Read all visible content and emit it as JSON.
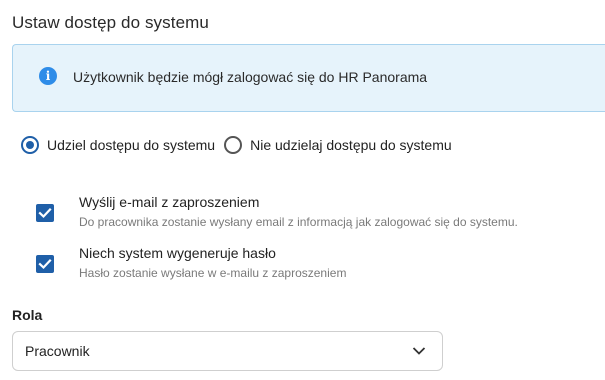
{
  "section": {
    "title": "Ustaw dostęp do systemu"
  },
  "info": {
    "icon": "info-icon",
    "text": "Użytkownik będzie mógł zalogować się do HR Panorama",
    "colors": {
      "background": "#e6f3fb",
      "border": "#a9d3ee",
      "icon": "#2e8ce8"
    }
  },
  "access": {
    "selected": "grant",
    "options": [
      {
        "id": "grant",
        "label": "Udziel dostępu do systemu",
        "checked": true
      },
      {
        "id": "deny",
        "label": "Nie udzielaj dostępu do systemu",
        "checked": false
      }
    ]
  },
  "options": {
    "send_invite": {
      "checked": true,
      "label": "Wyślij e-mail z zaproszeniem",
      "description": "Do pracownika zostanie wysłany email z informacją jak zalogować się do systemu."
    },
    "generate_password": {
      "checked": true,
      "label": "Niech system wygeneruje hasło",
      "description": "Hasło zostanie wysłane w e-mailu z zaproszeniem"
    }
  },
  "role": {
    "label": "Rola",
    "value": "Pracownik",
    "icon": "chevron-down-icon"
  },
  "colors": {
    "accent": "#1f5fa8"
  }
}
